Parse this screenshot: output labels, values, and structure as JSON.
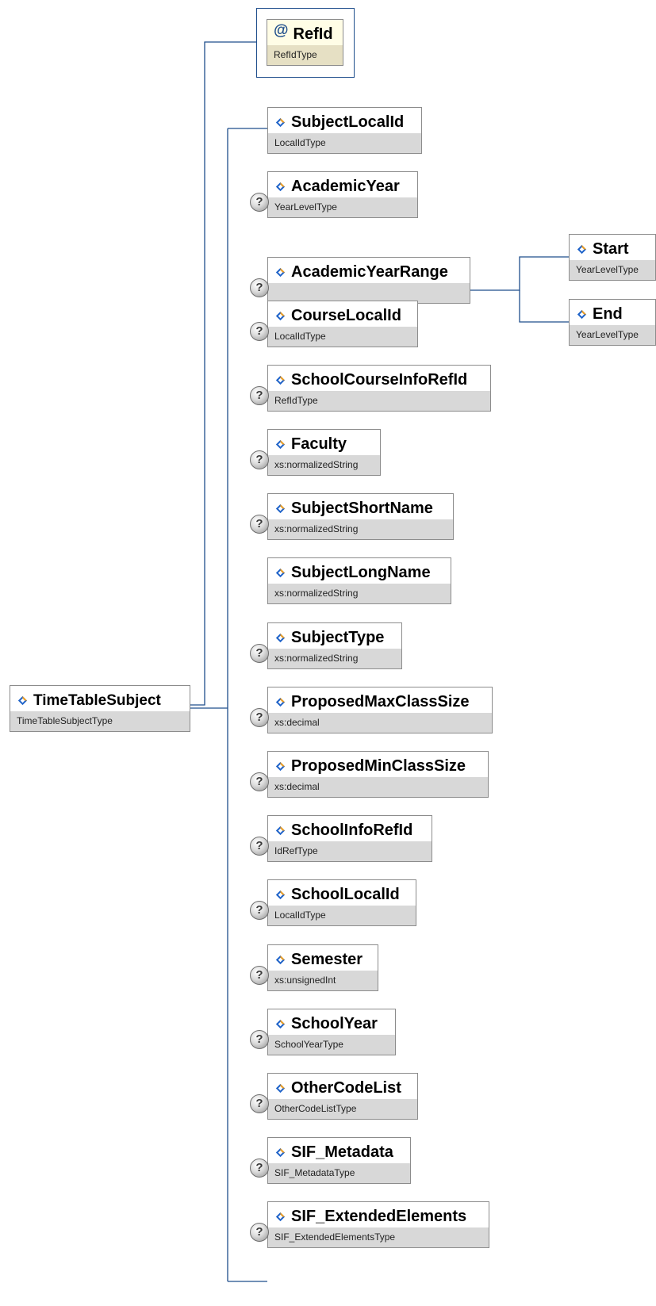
{
  "root": {
    "name": "TimeTableSubject",
    "type": "TimeTableSubjectType"
  },
  "attribute": {
    "name": "RefId",
    "type": "RefIdType"
  },
  "children": [
    {
      "name": "SubjectLocalId",
      "type": "LocalIdType",
      "optional": false
    },
    {
      "name": "AcademicYear",
      "type": "YearLevelType",
      "optional": true
    },
    {
      "name": "AcademicYearRange",
      "type": "",
      "optional": true
    },
    {
      "name": "CourseLocalId",
      "type": "LocalIdType",
      "optional": true
    },
    {
      "name": "SchoolCourseInfoRefId",
      "type": "RefIdType",
      "optional": true
    },
    {
      "name": "Faculty",
      "type": "xs:normalizedString",
      "optional": true
    },
    {
      "name": "SubjectShortName",
      "type": "xs:normalizedString",
      "optional": true
    },
    {
      "name": "SubjectLongName",
      "type": "xs:normalizedString",
      "optional": false
    },
    {
      "name": "SubjectType",
      "type": "xs:normalizedString",
      "optional": true
    },
    {
      "name": "ProposedMaxClassSize",
      "type": "xs:decimal",
      "optional": true
    },
    {
      "name": "ProposedMinClassSize",
      "type": "xs:decimal",
      "optional": true
    },
    {
      "name": "SchoolInfoRefId",
      "type": "IdRefType",
      "optional": true
    },
    {
      "name": "SchoolLocalId",
      "type": "LocalIdType",
      "optional": true
    },
    {
      "name": "Semester",
      "type": "xs:unsignedInt",
      "optional": true
    },
    {
      "name": "SchoolYear",
      "type": "SchoolYearType",
      "optional": true
    },
    {
      "name": "OtherCodeList",
      "type": "OtherCodeListType",
      "optional": true
    },
    {
      "name": "SIF_Metadata",
      "type": "SIF_MetadataType",
      "optional": true
    },
    {
      "name": "SIF_ExtendedElements",
      "type": "SIF_ExtendedElementsType",
      "optional": true
    }
  ],
  "range_children": [
    {
      "name": "Start",
      "type": "YearLevelType"
    },
    {
      "name": "End",
      "type": "YearLevelType"
    }
  ],
  "optional_marker": "?",
  "attribute_marker": "@",
  "icons": {
    "element": "element-diamond-icon",
    "optional": "optional-question-icon",
    "attribute": "attribute-at-icon"
  },
  "colors": {
    "connector": "#1f4e8c",
    "type_band": "#d8d8d8",
    "attribute_fill": "#fffde6",
    "diamond_blue": "#1e62c8",
    "diamond_orange": "#f2a020"
  }
}
